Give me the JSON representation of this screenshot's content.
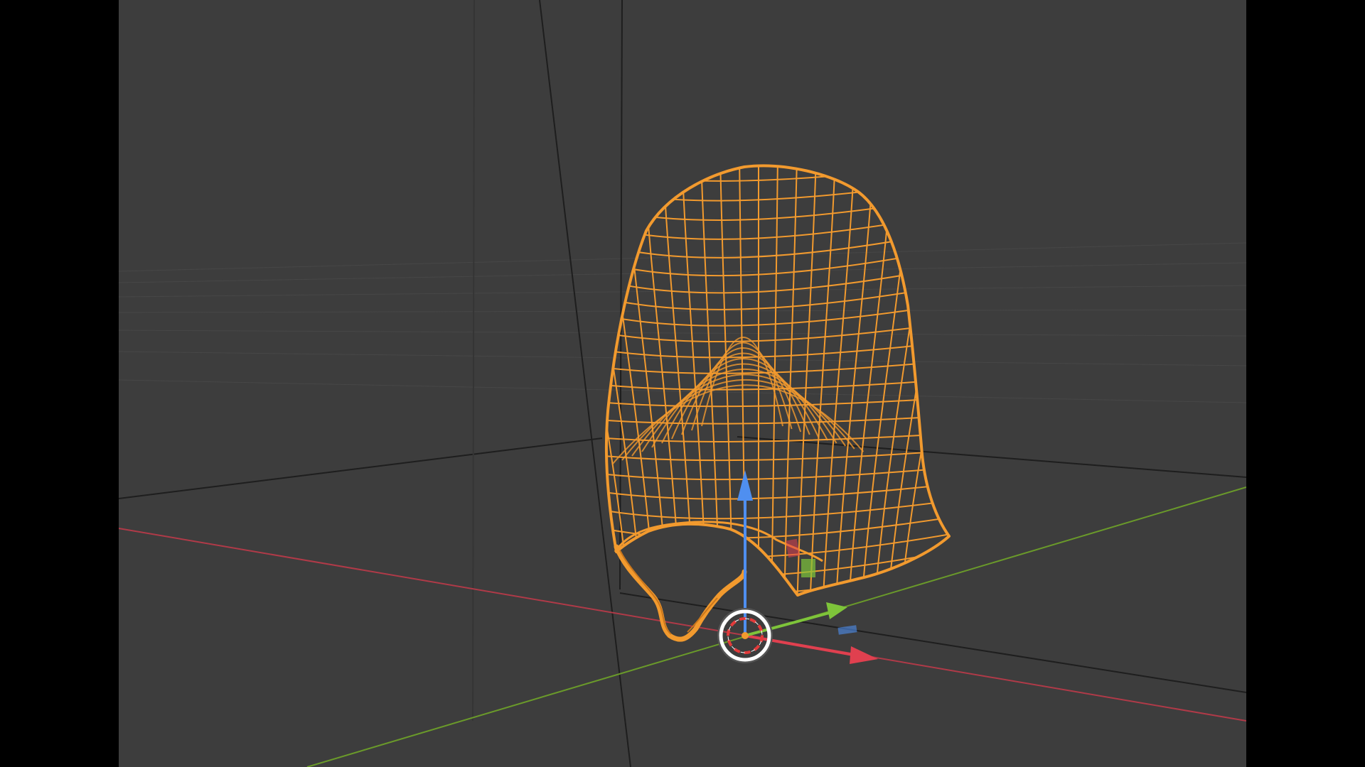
{
  "app": {
    "name": "3D viewport",
    "view_mode": "wireframe"
  },
  "viewport": {
    "background_color": "#3d3d3d",
    "letterbox_color": "#000000",
    "grid_color": "#4a4a4a",
    "x_axis_color": "#b03a48",
    "y_axis_color": "#6a9a2a"
  },
  "object": {
    "type": "hood-mesh",
    "state": "selected",
    "wire_color": "#f29a2e"
  },
  "gizmo": {
    "type": "move",
    "z_arrow_color": "#4f8ff0",
    "x_arrow_color": "#e0404f",
    "y_arrow_color": "#7ec43a"
  },
  "cursor": {
    "type": "3d-cursor",
    "ring_colors": [
      "#ffffff",
      "#e23b3b"
    ]
  }
}
